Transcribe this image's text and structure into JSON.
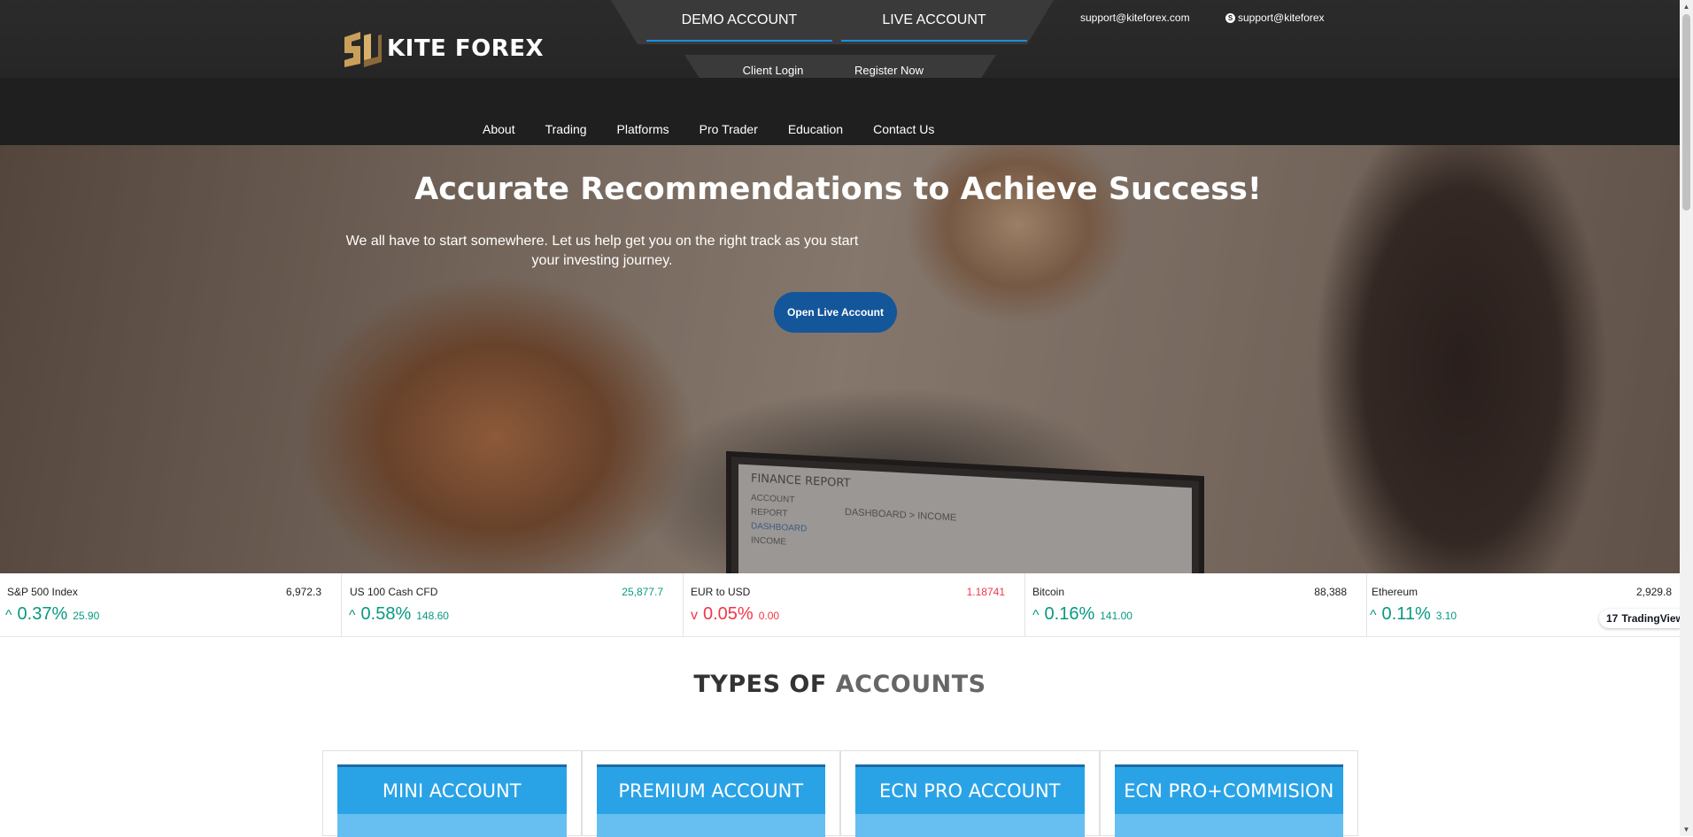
{
  "header": {
    "logo_text": "KITE FOREX",
    "account_tabs": {
      "demo": "DEMO ACCOUNT",
      "live": "LIVE ACCOUNT"
    },
    "login_tabs": {
      "client_login": "Client Login",
      "register": "Register Now"
    },
    "email": "support@kiteforex.com",
    "skype": "support@kiteforex"
  },
  "nav": {
    "items": [
      {
        "label": "About"
      },
      {
        "label": "Trading"
      },
      {
        "label": "Platforms"
      },
      {
        "label": "Pro Trader"
      },
      {
        "label": "Education"
      },
      {
        "label": "Contact Us"
      }
    ]
  },
  "hero": {
    "title": "Accurate Recommendations to Achieve Success!",
    "subtitle": "We all have to start somewhere. Let us help get you on the right track as you start your investing journey.",
    "button": "Open Live Account",
    "screen_title": "FINANCE REPORT",
    "screen_items": [
      "ACCOUNT",
      "REPORT",
      "DASHBOARD",
      "INCOME"
    ],
    "screen_header": "DASHBOARD > INCOME"
  },
  "ticker": {
    "items": [
      {
        "name": "S&P 500 Index",
        "price": "6,972.3",
        "change_pct": "0.37%",
        "change_abs": "25.90",
        "direction": "up",
        "price_color": "neutral"
      },
      {
        "name": "US 100 Cash CFD",
        "price": "25,877.7",
        "change_pct": "0.58%",
        "change_abs": "148.60",
        "direction": "up",
        "price_color": "up"
      },
      {
        "name": "EUR to USD",
        "price": "1.18741",
        "change_pct": "0.05%",
        "change_abs": "0.00",
        "direction": "down",
        "price_color": "down"
      },
      {
        "name": "Bitcoin",
        "price": "88,388",
        "change_pct": "0.16%",
        "change_abs": "141.00",
        "direction": "up",
        "price_color": "neutral"
      },
      {
        "name": "Ethereum",
        "price": "2,929.8",
        "change_pct": "0.11%",
        "change_abs": "3.10",
        "direction": "up",
        "price_color": "neutral"
      }
    ],
    "badge": "TradingView"
  },
  "accounts": {
    "title_dark": "TYPES OF",
    "title_light": "ACCOUNTS",
    "cards": [
      {
        "name": "MINI ACCOUNT"
      },
      {
        "name": "PREMIUM ACCOUNT"
      },
      {
        "name": "ECN PRO ACCOUNT"
      },
      {
        "name": "ECN PRO+COMMISION"
      }
    ]
  },
  "colors": {
    "header_bg": "#262626",
    "accent_blue": "#1a8ee0",
    "accent_green": "#7ed321",
    "button_blue": "#14569a",
    "card_blue": "#2aa3e6",
    "ticker_up": "#089981",
    "ticker_down": "#f23645",
    "logo_gold": "#c9a05a"
  },
  "icons": {
    "skype": "skype-icon",
    "ticker_up": "caret-up-icon",
    "ticker_down": "caret-down-icon",
    "tradingview": "tradingview-logo-icon"
  }
}
